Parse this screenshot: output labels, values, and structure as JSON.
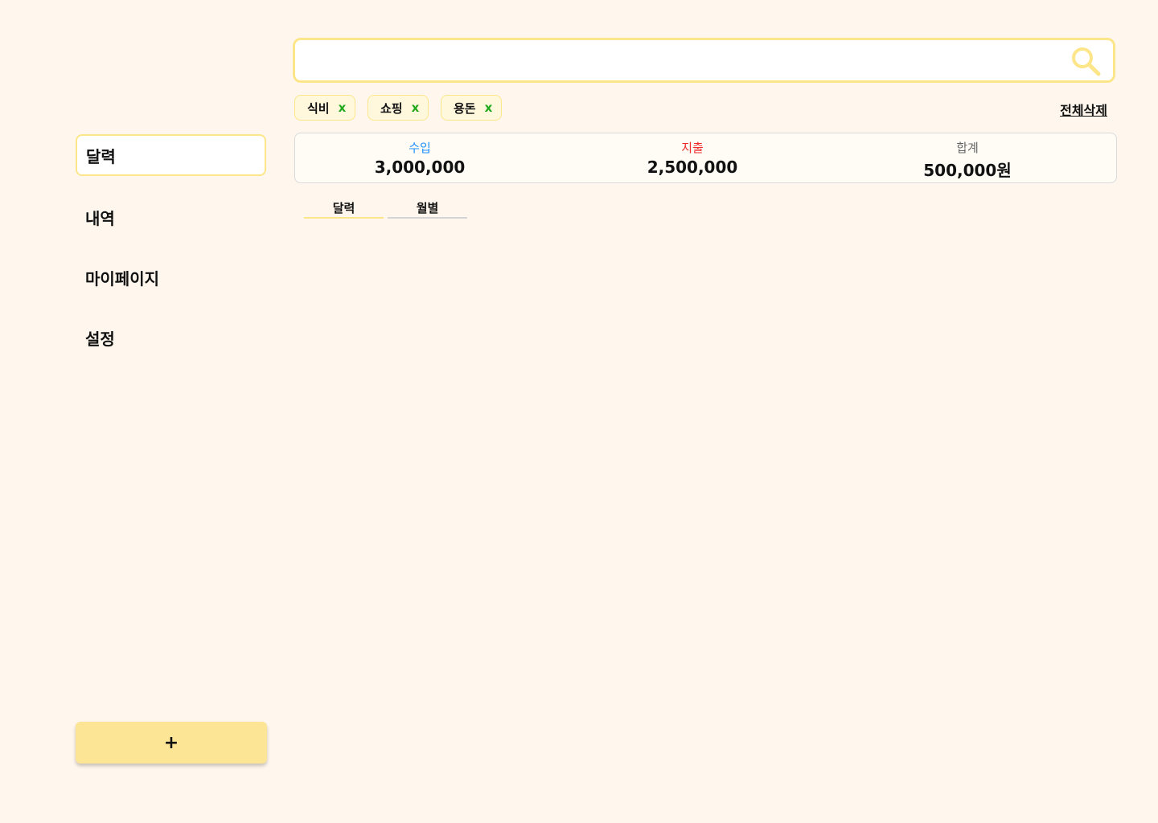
{
  "colors": {
    "background": "#fff7ed",
    "accent_yellow": "#fde68a",
    "add_button": "#fde596",
    "income": "#1e90ff",
    "expense": "#ef2b2b",
    "total_label": "#666666",
    "chip_remove": "#22a91e"
  },
  "sidebar": {
    "items": [
      {
        "label": "달력",
        "active": true
      },
      {
        "label": "내역",
        "active": false
      },
      {
        "label": "마이페이지",
        "active": false
      },
      {
        "label": "설정",
        "active": false
      }
    ],
    "add_button_label": "+"
  },
  "search": {
    "value": "",
    "placeholder": "",
    "icon": "search-icon"
  },
  "filters": {
    "chips": [
      {
        "label": "식비",
        "remove": "x"
      },
      {
        "label": "쇼핑",
        "remove": "x"
      },
      {
        "label": "용돈",
        "remove": "x"
      }
    ],
    "clear_all_label": "전체삭제"
  },
  "summary": {
    "income": {
      "label": "수입",
      "value": "3,000,000"
    },
    "expense": {
      "label": "지출",
      "value": "2,500,000"
    },
    "total": {
      "label": "합계",
      "value": "500,000원"
    }
  },
  "view_tabs": [
    {
      "label": "달력",
      "active": true
    },
    {
      "label": "월별",
      "active": false
    }
  ]
}
